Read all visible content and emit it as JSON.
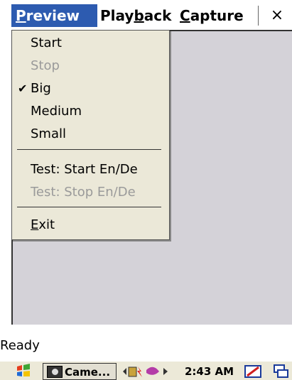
{
  "menubar": {
    "menus": [
      {
        "label_pre": "",
        "accel": "P",
        "label_post": "review",
        "active": true
      },
      {
        "label_pre": "Play",
        "accel": "b",
        "label_post": "ack",
        "active": false
      },
      {
        "label_pre": "",
        "accel": "C",
        "label_post": "apture",
        "active": false
      }
    ],
    "close_label": "×"
  },
  "preview_menu": {
    "items": [
      {
        "label": "Start",
        "enabled": true,
        "checked": false
      },
      {
        "label": "Stop",
        "enabled": false,
        "checked": false
      },
      {
        "label": "Big",
        "enabled": true,
        "checked": true
      },
      {
        "label": "Medium",
        "enabled": true,
        "checked": false
      },
      {
        "label": "Small",
        "enabled": true,
        "checked": false
      },
      {
        "label": "Test: Start En/De",
        "enabled": true,
        "checked": false
      },
      {
        "label": "Test: Stop En/De",
        "enabled": false,
        "checked": false
      }
    ],
    "exit": {
      "accel": "E",
      "label_post": "xit"
    },
    "check_glyph": "✔"
  },
  "status": {
    "text": "Ready"
  },
  "taskbar": {
    "task_label": "Came...",
    "clock": "2:43 AM"
  },
  "colors": {
    "menu_highlight": "#2d5bb0",
    "menu_bg": "#ebe8d8",
    "client_bg": "#d4d2d8",
    "disabled_text": "#9a9a9a"
  }
}
